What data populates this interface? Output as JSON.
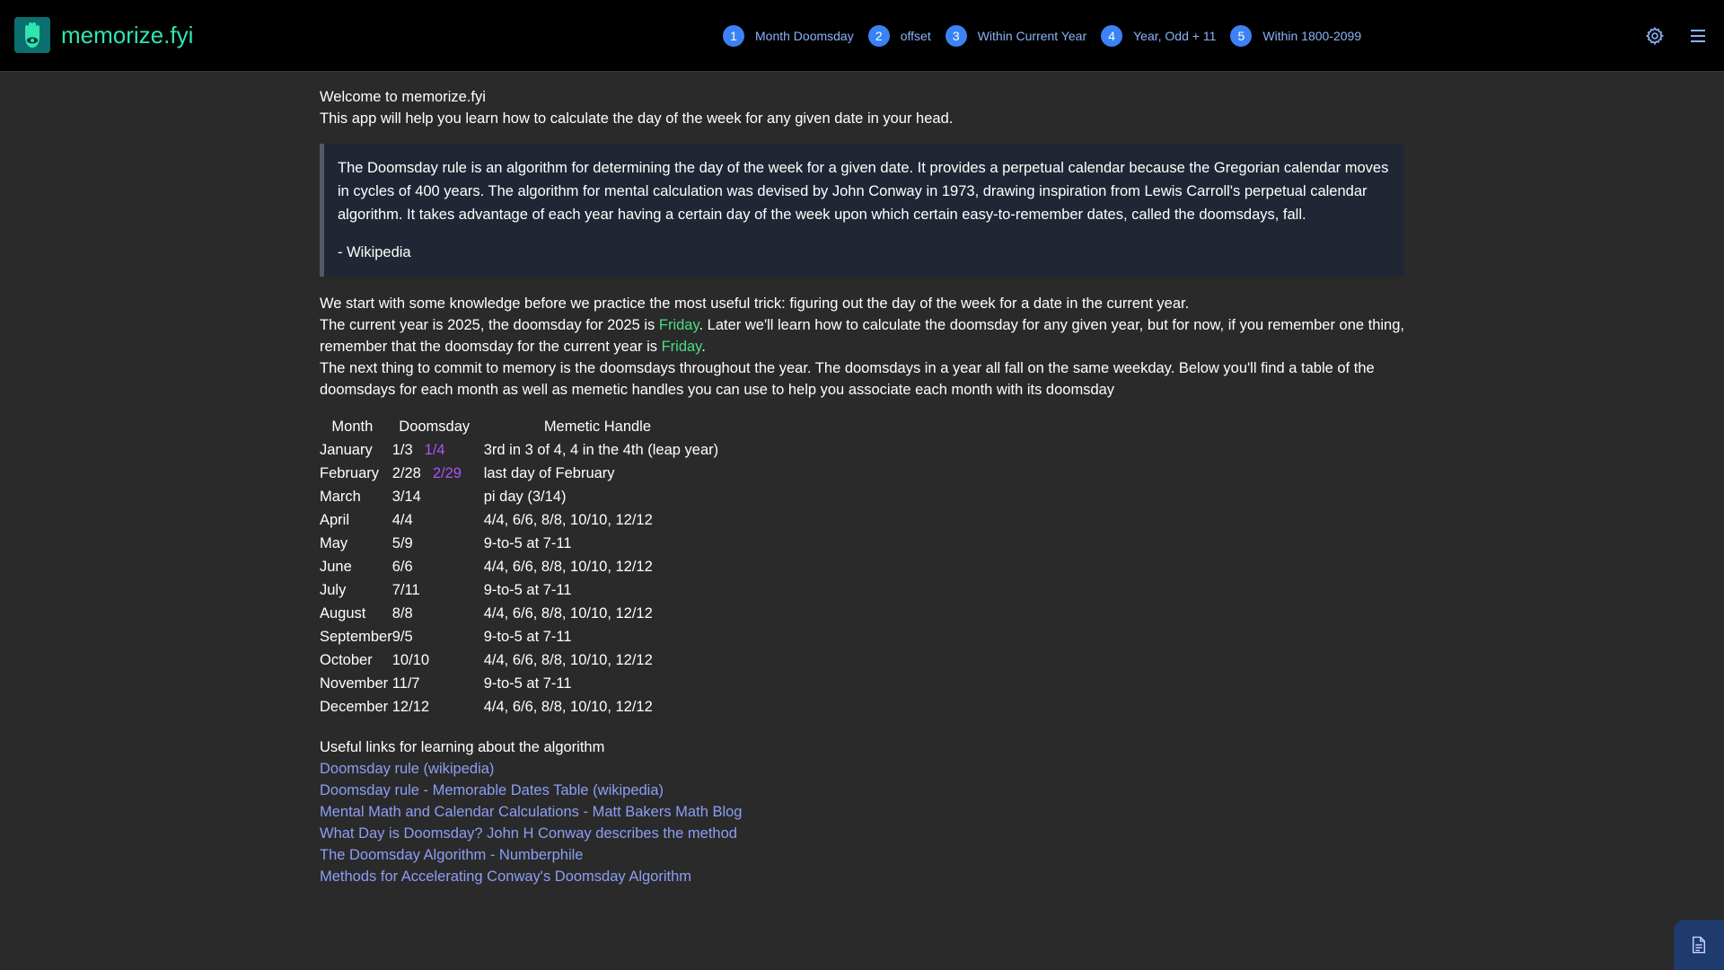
{
  "app": {
    "brand": "memorize.fyi",
    "logo_icon": "hamsa-eye-icon"
  },
  "nav": {
    "steps": [
      {
        "num": "1",
        "label": "Month Doomsday"
      },
      {
        "num": "2",
        "label": "offset"
      },
      {
        "num": "3",
        "label": "Within Current Year"
      },
      {
        "num": "4",
        "label": "Year, Odd + 11"
      },
      {
        "num": "5",
        "label": "Within 1800-2099"
      }
    ],
    "settings_icon": "gear-icon",
    "menu_icon": "hamburger-menu-icon"
  },
  "intro": {
    "line1": "Welcome to memorize.fyi",
    "line2": "This app will help you learn how to calculate the day of the week for any given date in your head."
  },
  "quote": {
    "text": "The Doomsday rule is an algorithm for determining the day of the week for a given date. It provides a perpetual calendar because the Gregorian calendar moves in cycles of 400 years. The algorithm for mental calculation was devised by John Conway in 1973, drawing inspiration from Lewis Carroll's perpetual calendar algorithm. It takes advantage of each year having a certain day of the week upon which certain easy-to-remember dates, called the doomsdays, fall.",
    "source": "- Wikipedia"
  },
  "body": {
    "p1": "We start with some knowledge before we practice the most useful trick: figuring out the day of the week for a date in the current year.",
    "p2_a": "The current year is 2025, the doomsday for 2025 is ",
    "p2_day": "Friday",
    "p2_b": ". Later we'll learn how to calculate the doomsday for any given year, but for now, if you remember one thing, remember that the doomsday for the current year is ",
    "p2_day2": "Friday",
    "p2_c": ".",
    "p3": "The next thing to commit to memory is the doomsdays throughout the year. The doomsdays in a year all fall on the same weekday. Below you'll find a table of the doomsdays for each month as well as memetic handles you can use to help you associate each month with its doomsday"
  },
  "table": {
    "headers": {
      "month": "Month",
      "doomsday": "Doomsday",
      "handle": "Memetic Handle"
    },
    "rows": [
      {
        "month": "January",
        "doomsday": "1/3",
        "leap": "1/4",
        "handle": "3rd in 3 of 4, 4 in the 4th (leap year)"
      },
      {
        "month": "February",
        "doomsday": "2/28",
        "leap": "2/29",
        "handle": "last day of February"
      },
      {
        "month": "March",
        "doomsday": "3/14",
        "leap": "",
        "handle": "pi day (3/14)"
      },
      {
        "month": "April",
        "doomsday": "4/4",
        "leap": "",
        "handle": "4/4, 6/6, 8/8, 10/10, 12/12"
      },
      {
        "month": "May",
        "doomsday": "5/9",
        "leap": "",
        "handle": "9-to-5 at 7-11"
      },
      {
        "month": "June",
        "doomsday": "6/6",
        "leap": "",
        "handle": "4/4, 6/6, 8/8, 10/10, 12/12"
      },
      {
        "month": "July",
        "doomsday": "7/11",
        "leap": "",
        "handle": "9-to-5 at 7-11"
      },
      {
        "month": "August",
        "doomsday": "8/8",
        "leap": "",
        "handle": "4/4, 6/6, 8/8, 10/10, 12/12"
      },
      {
        "month": "September",
        "doomsday": "9/5",
        "leap": "",
        "handle": "9-to-5 at 7-11"
      },
      {
        "month": "October",
        "doomsday": "10/10",
        "leap": "",
        "handle": "4/4, 6/6, 8/8, 10/10, 12/12"
      },
      {
        "month": "November",
        "doomsday": "11/7",
        "leap": "",
        "handle": "9-to-5 at 7-11"
      },
      {
        "month": "December",
        "doomsday": "12/12",
        "leap": "",
        "handle": "4/4, 6/6, 8/8, 10/10, 12/12"
      }
    ]
  },
  "links": {
    "heading": "Useful links for learning about the algorithm",
    "items": [
      "Doomsday rule (wikipedia)",
      "Doomsday rule - Memorable Dates Table (wikipedia)",
      "Mental Math and Calendar Calculations - Matt Bakers Math Blog",
      "What Day is Doomsday? John H Conway describes the method",
      "The Doomsday Algorithm - Numberphile",
      "Methods for Accelerating Conway's Doomsday Algorithm"
    ]
  },
  "floating": {
    "doc_icon": "document-icon"
  },
  "colors": {
    "accent_green": "#4ade80",
    "brand_teal": "#2fe6b0",
    "link_blue": "#8c9ef5",
    "leap_purple": "#a855f7",
    "step_blue": "#3b82f6"
  }
}
